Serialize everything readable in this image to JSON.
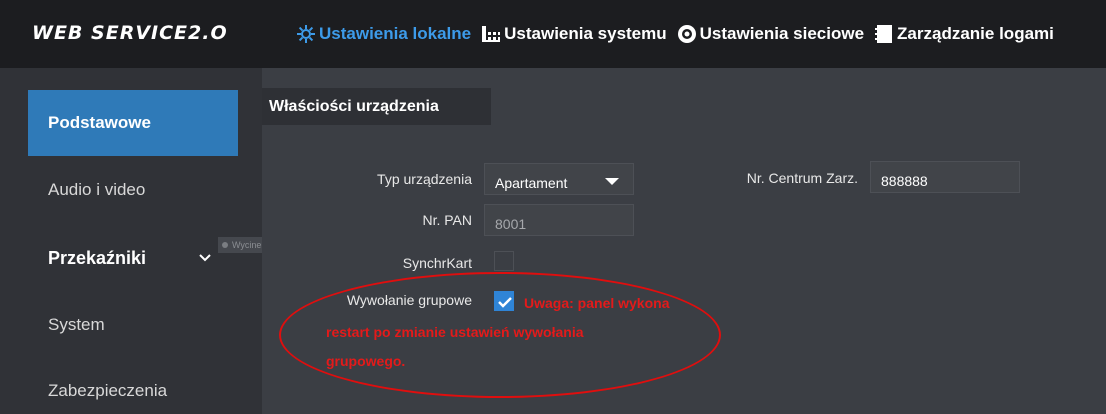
{
  "app": {
    "logo": "WEB SERVICE2.O"
  },
  "nav": {
    "items": [
      {
        "label": "Ustawienia lokalne",
        "icon": "gear-icon",
        "active": true
      },
      {
        "label": "Ustawienia systemu",
        "icon": "system-grid-icon",
        "active": false
      },
      {
        "label": "Ustawienia sieciowe",
        "icon": "network-globe-icon",
        "active": false
      },
      {
        "label": "Zarządzanie logami",
        "icon": "log-document-icon",
        "active": false
      }
    ]
  },
  "sidebar": {
    "items": [
      {
        "label": "Podstawowe",
        "active": true
      },
      {
        "label": "Audio i video"
      },
      {
        "label": "Przekaźniki",
        "expandable": true
      },
      {
        "label": "System"
      },
      {
        "label": "Zabezpieczenia"
      }
    ]
  },
  "ghost": {
    "text": "Wycinek prostokątny"
  },
  "tab": {
    "label": "Właściości urządzenia"
  },
  "form": {
    "device_type": {
      "label": "Typ urządzenia",
      "value": "Apartament"
    },
    "pan": {
      "label": "Nr. PAN",
      "value": "8001"
    },
    "sync": {
      "label": "SynchrKart",
      "checked": false
    },
    "group_call": {
      "label": "Wywołanie grupowe",
      "checked": true
    },
    "center": {
      "label": "Nr. Centrum Zarz.",
      "value": "888888"
    }
  },
  "warning": {
    "line1": "Uwaga: panel wykona",
    "line2": "restart po zmianie ustawień wywołania",
    "line3": "grupowego."
  },
  "colors": {
    "accent": "#3d9be9",
    "active_sidebar": "#2f7ab8",
    "warning": "#e41a1a",
    "annotation": "#e00e0e"
  }
}
